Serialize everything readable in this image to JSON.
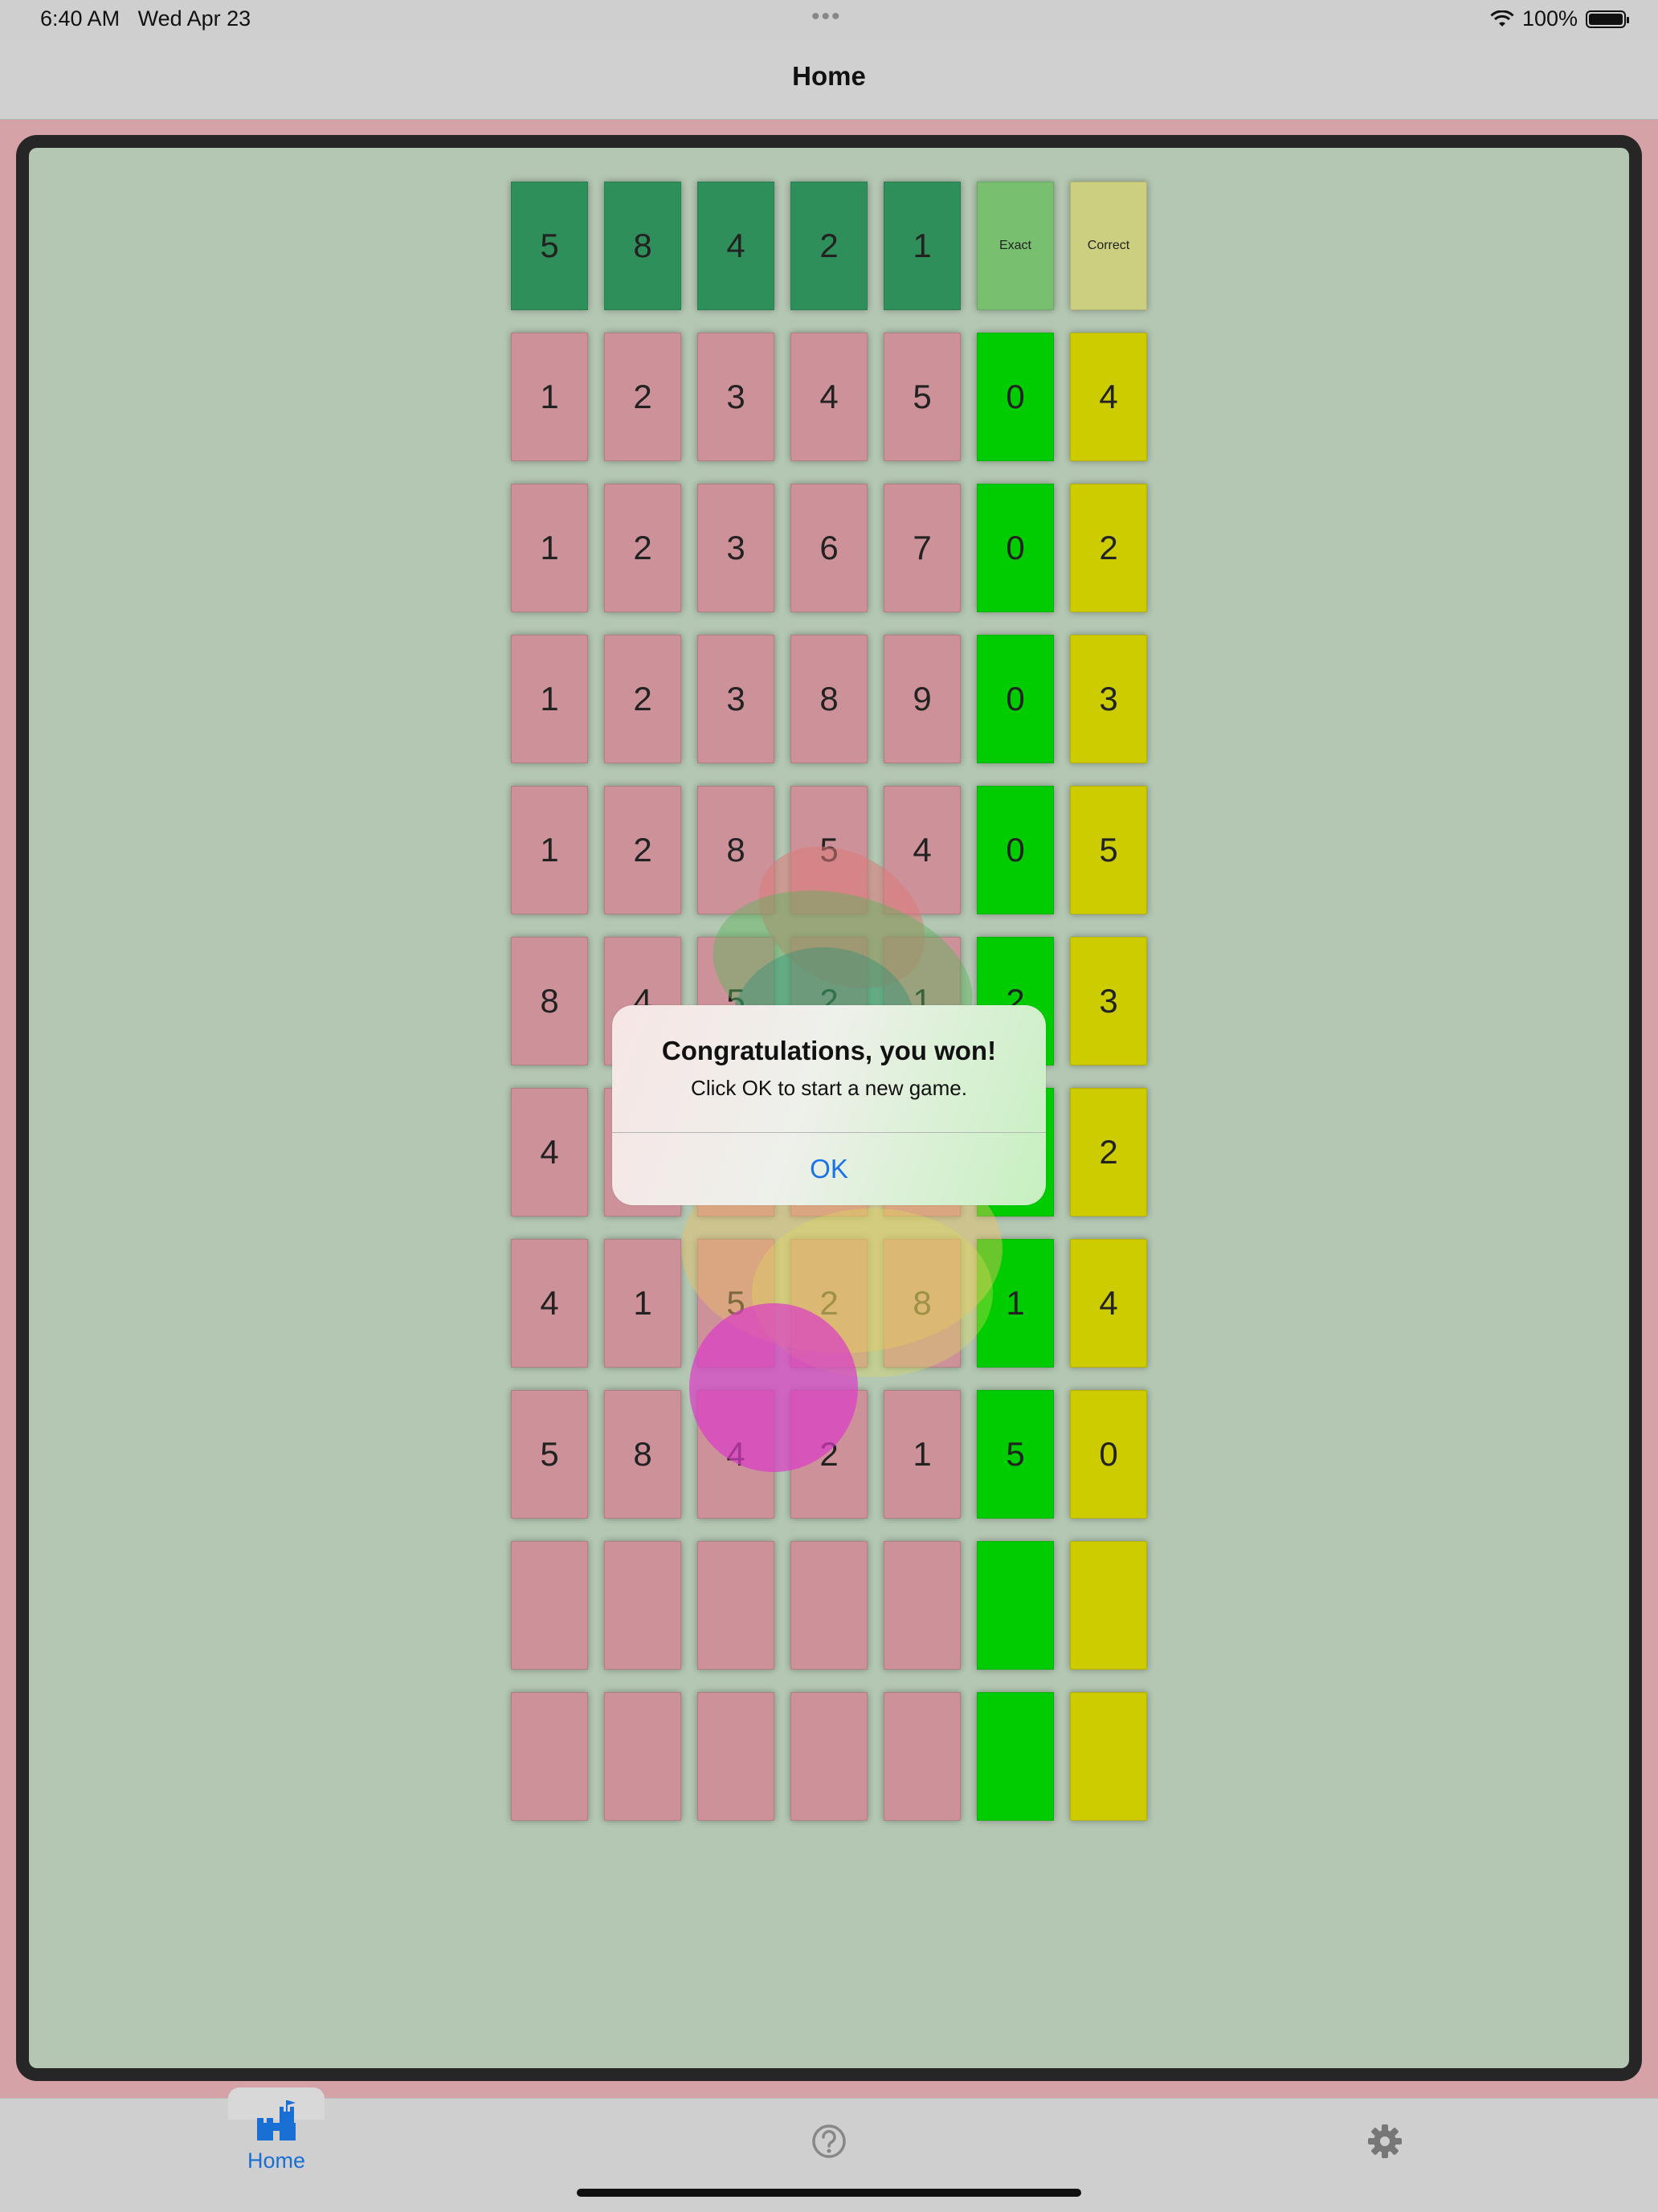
{
  "status_bar": {
    "time": "6:40 AM",
    "date": "Wed Apr 23",
    "battery": "100%"
  },
  "nav": {
    "title": "Home"
  },
  "board": {
    "header": {
      "secret": [
        "5",
        "8",
        "4",
        "2",
        "1"
      ],
      "exact_label": "Exact",
      "correct_label": "Correct"
    },
    "rows": [
      {
        "guess": [
          "1",
          "2",
          "3",
          "4",
          "5"
        ],
        "exact": "0",
        "correct": "4"
      },
      {
        "guess": [
          "1",
          "2",
          "3",
          "6",
          "7"
        ],
        "exact": "0",
        "correct": "2"
      },
      {
        "guess": [
          "1",
          "2",
          "3",
          "8",
          "9"
        ],
        "exact": "0",
        "correct": "3"
      },
      {
        "guess": [
          "1",
          "2",
          "8",
          "5",
          "4"
        ],
        "exact": "0",
        "correct": "5"
      },
      {
        "guess": [
          "8",
          "4",
          "5",
          "2",
          "1"
        ],
        "exact": "2",
        "correct": "3"
      },
      {
        "guess": [
          "4",
          "",
          "",
          "",
          ""
        ],
        "exact": "",
        "correct": "2"
      },
      {
        "guess": [
          "4",
          "1",
          "5",
          "2",
          "8"
        ],
        "exact": "1",
        "correct": "4"
      },
      {
        "guess": [
          "5",
          "8",
          "4",
          "2",
          "1"
        ],
        "exact": "5",
        "correct": "0"
      },
      {
        "guess": [
          "",
          "",
          "",
          "",
          ""
        ],
        "exact": "",
        "correct": ""
      },
      {
        "guess": [
          "",
          "",
          "",
          "",
          ""
        ],
        "exact": "",
        "correct": ""
      }
    ],
    "colors": {
      "guess": "#cd9299",
      "exact": "#00cc00",
      "correct": "#cccc00",
      "secret": "#2f8f5a"
    }
  },
  "alert": {
    "title": "Congratulations, you won!",
    "message": "Click OK to start a new game.",
    "ok_label": "OK"
  },
  "tab_bar": {
    "items": [
      {
        "label": "Home",
        "icon": "castle-icon",
        "selected": true
      },
      {
        "label": "",
        "icon": "question-circle-icon",
        "selected": false
      },
      {
        "label": "",
        "icon": "gear-icon",
        "selected": false
      }
    ]
  }
}
